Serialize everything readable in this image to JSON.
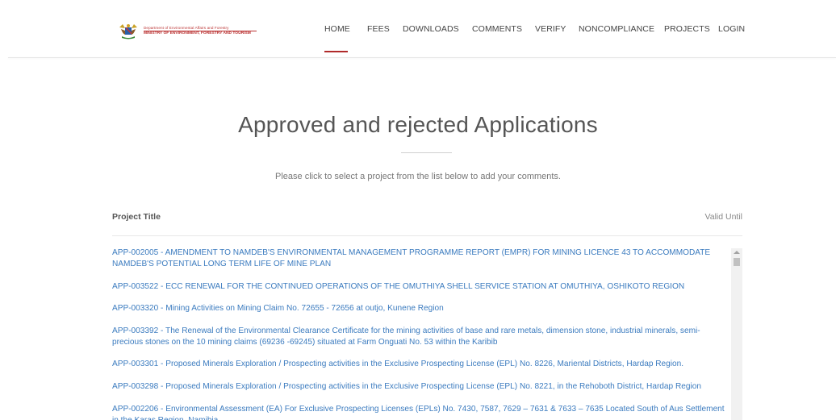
{
  "header": {
    "logo": {
      "line1": "Department of Environmental Affairs and Forestry",
      "line2": "MINISTRY OF ENVIRONMENT, FORESTRY AND TOURISM",
      "icon": "coat-of-arms-icon"
    },
    "nav": [
      {
        "label": "HOME",
        "active": true
      },
      {
        "label": "FEES"
      },
      {
        "label": "DOWNLOADS"
      },
      {
        "label": "COMMENTS"
      },
      {
        "label": "VERIFY"
      },
      {
        "label": "NONCOMPLIANCE"
      },
      {
        "label": "PROJECTS"
      },
      {
        "label": "LOGIN"
      }
    ],
    "accent": "#b02a2a"
  },
  "main": {
    "title": "Approved and rejected Applications",
    "subtitle": "Please click to select a project from the list below to add your comments.",
    "columns": {
      "title": "Project Title",
      "valid": "Valid Until"
    },
    "link_color": "#3b7bbf",
    "items": [
      {
        "text": "APP-002005 - AMENDMENT TO NAMDEB'S ENVIRONMENTAL MANAGEMENT PROGRAMME REPORT (EMPR) FOR MINING LICENCE 43 TO ACCOMMODATE NAMDEB'S POTENTIAL LONG TERM LIFE OF MINE PLAN"
      },
      {
        "text": "APP-003522 - ECC RENEWAL FOR THE CONTINUED OPERATIONS OF THE OMUTHIYA SHELL SERVICE STATION AT OMUTHIYA, OSHIKOTO REGION"
      },
      {
        "text": "APP-003320 - Mining Activities on Mining Claim No. 72655 - 72656 at outjo, Kunene Region"
      },
      {
        "text": "APP-003392 - The Renewal of the Environmental Clearance Certificate for the mining activities of base and rare metals, dimension stone, industrial minerals, semi-precious stones on the 10 mining claims (69236 -69245) situated at Farm Onguati No. 53 within the Karibib"
      },
      {
        "text": "APP-003301 - Proposed Minerals Exploration / Prospecting activities in the Exclusive Prospecting License (EPL) No. 8226, Mariental Districts, Hardap Region."
      },
      {
        "text": "APP-003298 - Proposed Minerals Exploration / Prospecting activities in the Exclusive Prospecting License (EPL) No. 8221, in the Rehoboth District, Hardap Region"
      },
      {
        "text": "APP-002206 - Environmental Assessment (EA) For Exclusive Prospecting Licenses (EPLs) No. 7430, 7587, 7629 – 7631 & 7633 – 7635 Located South of Aus Settlement in the Karas Region, Namibia"
      }
    ]
  }
}
